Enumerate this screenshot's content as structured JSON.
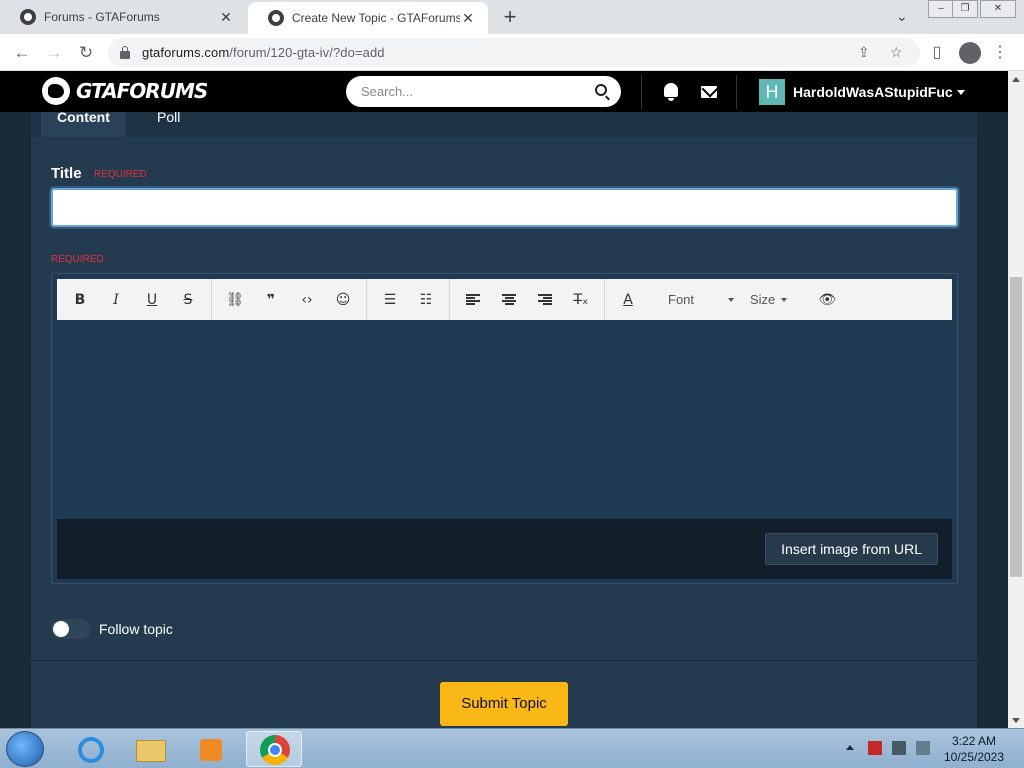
{
  "browser": {
    "tabs": [
      {
        "title": "Forums - GTAForums",
        "close": "✕"
      },
      {
        "title": "Create New Topic - GTAForums",
        "close": "✕"
      }
    ],
    "new_tab": "+",
    "url_host": "gtaforums.com",
    "url_path": "/forum/120-gta-iv/?do=add"
  },
  "site": {
    "logo_text": "GTAFORUMS",
    "search_placeholder": "Search...",
    "avatar_letter": "H",
    "username": "HardoldWasAStupidFuc",
    "avatar_color": "#5fb8b3"
  },
  "form": {
    "tabs": [
      "Content",
      "Poll"
    ],
    "title_label": "Title",
    "required_text": "REQUIRED",
    "title_value": "",
    "toolbar": {
      "bold": "B",
      "italic": "I",
      "underline": "U",
      "strike": "S",
      "font": "Font",
      "size": "Size",
      "text_color": "A"
    },
    "insert_image": "Insert image from URL",
    "follow_label": "Follow topic",
    "follow_on": false,
    "submit": "Submit Topic",
    "submit_color": "#fab817",
    "required_color": "#e0313f"
  },
  "taskbar": {
    "time": "3:22 AM",
    "date": "10/25/2023"
  }
}
